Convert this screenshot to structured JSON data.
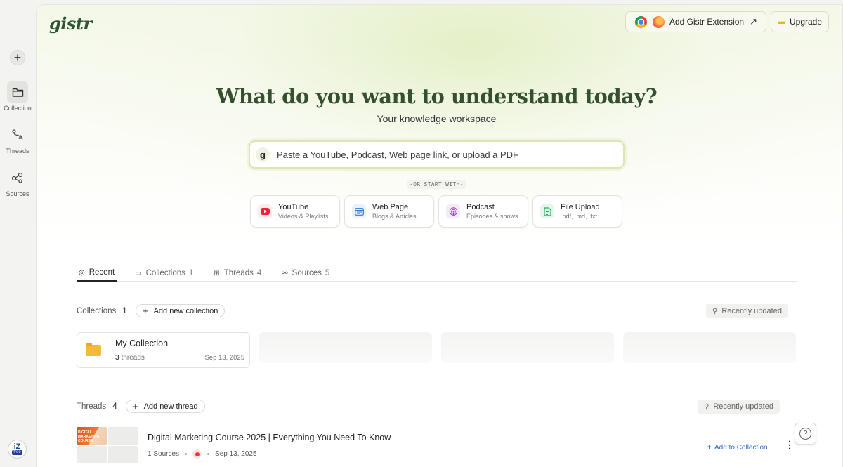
{
  "sidebar": {
    "new_label": "+",
    "items": [
      {
        "label": "Collection",
        "icon": "folder-icon",
        "active": true
      },
      {
        "label": "Threads",
        "icon": "threads-icon",
        "active": false
      },
      {
        "label": "Sources",
        "icon": "sources-icon",
        "active": false
      }
    ],
    "badge_top": "iZ",
    "badge_bottom": "free"
  },
  "header": {
    "logo": "gistr",
    "extension_label": "Add Gistr Extension",
    "upgrade_label": "Upgrade"
  },
  "hero": {
    "title": "What do you want to understand today?",
    "subtitle": "Your knowledge workspace",
    "search_placeholder": "Paste a YouTube, Podcast, Web page link, or upload a PDF",
    "divider": "-OR START WITH-"
  },
  "source_types": [
    {
      "title": "YouTube",
      "subtitle": "Videos & Playlists",
      "icon": "youtube-icon",
      "color": "#ff1f3d"
    },
    {
      "title": "Web Page",
      "subtitle": "Blogs & Articles",
      "icon": "webpage-icon",
      "color": "#2f7bd6"
    },
    {
      "title": "Podcast",
      "subtitle": "Episodes & shows",
      "icon": "podcast-icon",
      "color": "#9a44d6"
    },
    {
      "title": "File Upload",
      "subtitle": ".pdf, .md, .txt",
      "icon": "file-icon",
      "color": "#2da85a"
    }
  ],
  "tabs": [
    {
      "label": "Recent",
      "count": "",
      "active": true
    },
    {
      "label": "Collections",
      "count": "1",
      "active": false
    },
    {
      "label": "Threads",
      "count": "4",
      "active": false
    },
    {
      "label": "Sources",
      "count": "5",
      "active": false
    }
  ],
  "collections": {
    "label": "Collections",
    "count": "1",
    "add_label": "Add new collection",
    "sort_label": "Recently updated",
    "items": [
      {
        "name": "My Collection",
        "thread_count": "3",
        "thread_word": "threads",
        "date": "Sep 13, 2025"
      }
    ]
  },
  "threads": {
    "label": "Threads",
    "count": "4",
    "add_label": "Add new thread",
    "sort_label": "Recently updated",
    "items": [
      {
        "title": "Digital Marketing Course 2025 | Everything You Need To Know",
        "sources": "1 Sources",
        "date": "Sep 13, 2025",
        "thumb_text": "DIGITAL MARKETING COURSE",
        "add_label": "Add to Collection"
      }
    ]
  },
  "help_label": "?"
}
